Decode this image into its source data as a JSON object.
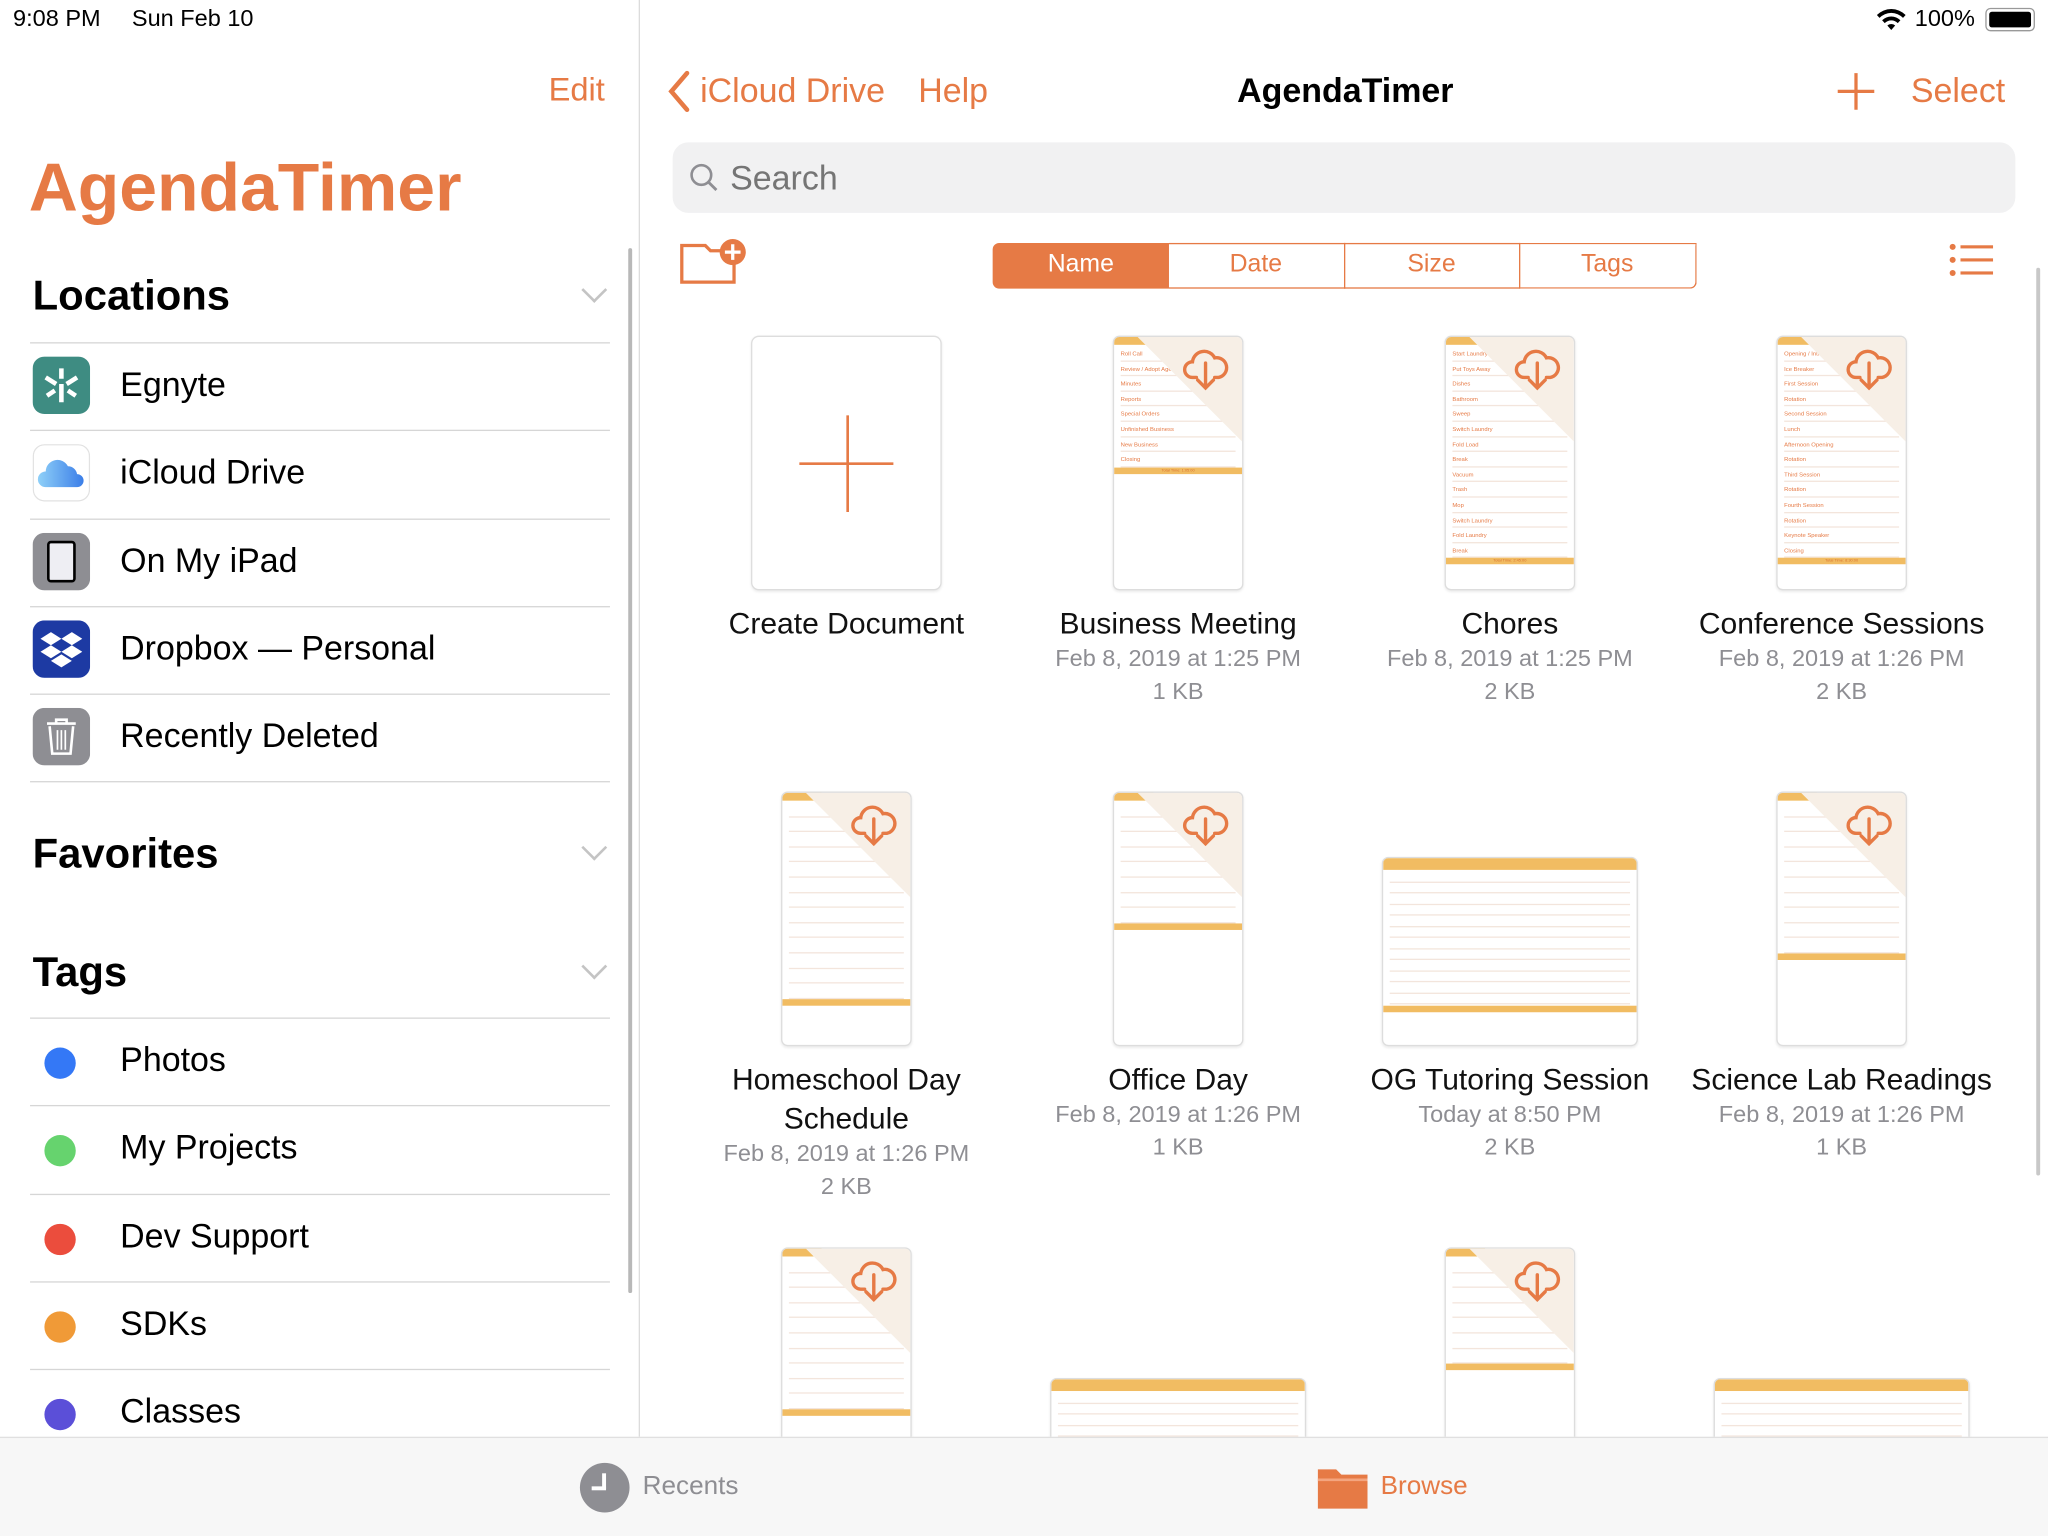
{
  "status_bar": {
    "time": "9:08 PM",
    "date": "Sun Feb 10",
    "battery": "100%"
  },
  "sidebar": {
    "edit_label": "Edit",
    "app_title": "AgendaTimer",
    "locations_title": "Locations",
    "locations": [
      {
        "label": "Egnyte",
        "icon": "egnyte-icon"
      },
      {
        "label": "iCloud Drive",
        "icon": "icloud-icon"
      },
      {
        "label": "On My iPad",
        "icon": "ipad-icon"
      },
      {
        "label": "Dropbox — Personal",
        "icon": "dropbox-icon"
      },
      {
        "label": "Recently Deleted",
        "icon": "trash-icon"
      }
    ],
    "favorites_title": "Favorites",
    "tags_title": "Tags",
    "tags": [
      {
        "label": "Photos",
        "color": "#3478f6"
      },
      {
        "label": "My Projects",
        "color": "#66d36e"
      },
      {
        "label": "Dev Support",
        "color": "#eb4d3d"
      },
      {
        "label": "SDKs",
        "color": "#f09a37"
      },
      {
        "label": "Classes",
        "color": "#5b4fd8"
      }
    ]
  },
  "nav": {
    "back_label": "iCloud Drive",
    "help_label": "Help",
    "title": "AgendaTimer",
    "select_label": "Select"
  },
  "search": {
    "placeholder": "Search"
  },
  "sort_tabs": [
    {
      "label": "Name",
      "selected": true
    },
    {
      "label": "Date",
      "selected": false
    },
    {
      "label": "Size",
      "selected": false
    },
    {
      "label": "Tags",
      "selected": false
    }
  ],
  "files": [
    {
      "name": "Create Document",
      "date": "",
      "size": "",
      "kind": "create"
    },
    {
      "name": "Business Meeting",
      "date": "Feb 8, 2019 at 1:25 PM",
      "size": "1 KB",
      "kind": "portrait",
      "rows": [
        "Roll Call",
        "Review / Adopt Agenda",
        "Minutes",
        "Reports",
        "Special Orders",
        "Unfinished Business",
        "New Business",
        "Closing"
      ],
      "total": "Total Time: 1:05:00"
    },
    {
      "name": "Chores",
      "date": "Feb 8, 2019 at 1:25 PM",
      "size": "2 KB",
      "kind": "portrait",
      "rows": [
        "Start Laundry",
        "Put Toys Away",
        "Dishes",
        "Bathroom",
        "Sweep",
        "Switch Laundry",
        "Fold Load",
        "Break",
        "Vacuum",
        "Trash",
        "Mop",
        "Switch Laundry",
        "Fold Laundry",
        "Break"
      ],
      "total": "Total Time: 2:45:00"
    },
    {
      "name": "Conference Sessions",
      "date": "Feb 8, 2019 at 1:26 PM",
      "size": "2 KB",
      "kind": "portrait",
      "rows": [
        "Opening / Introduction",
        "Ice Breaker",
        "First Session",
        "Rotation",
        "Second Session",
        "Lunch",
        "Afternoon Opening",
        "Rotation",
        "Third Session",
        "Rotation",
        "Fourth Session",
        "Rotation",
        "Keynote Speaker",
        "Closing"
      ],
      "total": "Total Time: 8:30:00"
    },
    {
      "name": "Homeschool Day Schedule",
      "date": "Feb 8, 2019 at 1:26 PM",
      "size": "2 KB",
      "kind": "portrait",
      "rowcount": 13
    },
    {
      "name": "Office Day",
      "date": "Feb 8, 2019 at 1:26 PM",
      "size": "1 KB",
      "kind": "portrait",
      "rowcount": 8
    },
    {
      "name": "OG Tutoring Session",
      "date": "Today at 8:50 PM",
      "size": "2 KB",
      "kind": "landscape",
      "rowcount": 12
    },
    {
      "name": "Science Lab Readings",
      "date": "Feb 8, 2019 at 1:26 PM",
      "size": "1 KB",
      "kind": "portrait",
      "rowcount": 10
    },
    {
      "name": "",
      "date": "",
      "size": "",
      "kind": "portrait",
      "rowcount": 10
    },
    {
      "name": "",
      "date": "",
      "size": "",
      "kind": "landscape",
      "rowcount": 4
    },
    {
      "name": "",
      "date": "",
      "size": "",
      "kind": "portrait",
      "rowcount": 7
    },
    {
      "name": "",
      "date": "",
      "size": "",
      "kind": "landscape",
      "rowcount": 4
    }
  ],
  "tabbar": {
    "recents_label": "Recents",
    "browse_label": "Browse"
  },
  "colors": {
    "accent": "#e67a45",
    "thumb_header": "#f1bc62"
  }
}
